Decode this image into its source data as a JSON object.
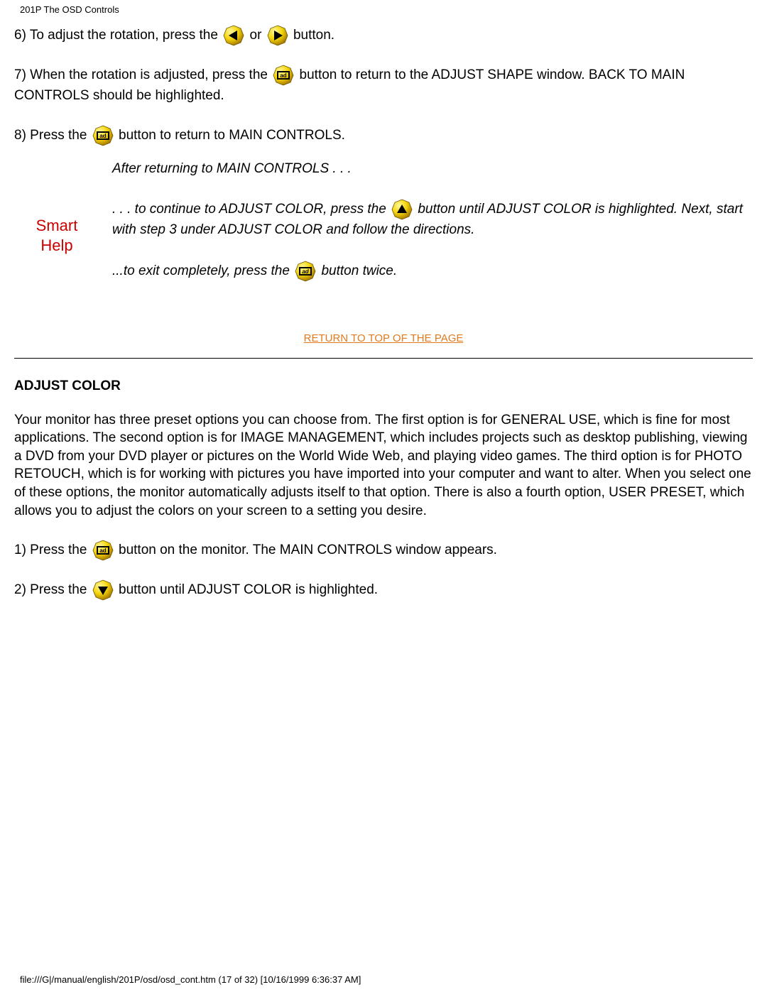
{
  "header": {
    "title": "201P The OSD Controls"
  },
  "s6": {
    "a": "6) To adjust the rotation, press the ",
    "or": " or ",
    "b": " button."
  },
  "s7": {
    "a": "7) When the rotation is adjusted, press the ",
    "b": " button to return to the ADJUST SHAPE window. BACK TO MAIN CONTROLS should be highlighted."
  },
  "s8": {
    "a": "8) Press the ",
    "b": " button to return to MAIN CONTROLS."
  },
  "smart": {
    "label1": "Smart",
    "label2": "Help",
    "p1": "After returning to MAIN CONTROLS . . .",
    "p2a": ". . . to continue to ADJUST COLOR, press the ",
    "p2b": " button until ADJUST COLOR is highlighted. Next, start with step 3 under ADJUST COLOR and follow the directions.",
    "p3a": "...to exit completely, press the ",
    "p3b": " button twice."
  },
  "returnLink": "RETURN TO TOP OF THE PAGE",
  "section": {
    "heading": "ADJUST COLOR",
    "para": "Your monitor has three preset options you can choose from. The first option is for GENERAL USE, which is fine for most applications. The second option is for IMAGE MANAGEMENT, which includes projects such as desktop publishing, viewing a DVD from your DVD player or pictures on the World Wide Web, and playing video games. The third option is for PHOTO RETOUCH, which is for working with pictures you have imported into your computer and want to alter. When you select one of these options, the monitor automatically adjusts itself to that option. There is also a fourth option, USER PRESET, which allows you to adjust the colors on your screen to a setting you desire."
  },
  "ac1": {
    "a": "1) Press the ",
    "b": " button on the monitor. The MAIN CONTROLS window appears."
  },
  "ac2": {
    "a": "2) Press the ",
    "b": " button until ADJUST COLOR is highlighted."
  },
  "footer": {
    "path": "file:///G|/manual/english/201P/osd/osd_cont.htm (17 of 32) [10/16/1999 6:36:37 AM]"
  }
}
